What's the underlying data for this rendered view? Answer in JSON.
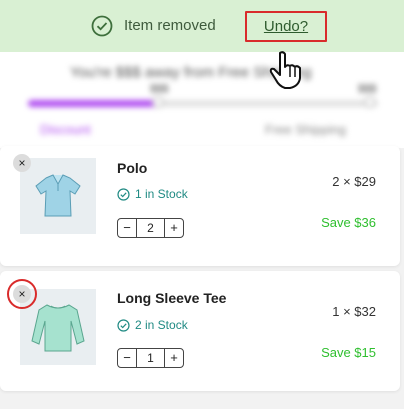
{
  "notice": {
    "message": "Item removed",
    "undo_label": "Undo?"
  },
  "shipping": {
    "text": "You're $$$ away from Free Shipping",
    "progress": 0.38,
    "tick_left_label": "$$$",
    "tick_right_label": "$$$",
    "reward_left": "Discount",
    "reward_right": "Free Shipping"
  },
  "items": [
    {
      "title": "Polo",
      "stock": "1 in Stock",
      "quantity": "2",
      "price": "2 × $29",
      "save": "Save $36",
      "remove_symbol": "×"
    },
    {
      "title": "Long Sleeve Tee",
      "stock": "2 in Stock",
      "quantity": "1",
      "price": "1 × $32",
      "save": "Save $15",
      "remove_symbol": "×"
    }
  ],
  "qty_controls": {
    "minus": "−",
    "plus": "+"
  },
  "colors": {
    "notice_bg": "#d9f0d3",
    "highlight": "#d92b2b",
    "progress": "#b14ef0",
    "stock": "#1f8a83",
    "save": "#2fbf2f"
  },
  "icons": {
    "notice": "check-circle-icon",
    "cursor": "hand-pointer-icon",
    "remove": "close-icon",
    "stock": "check-circle-icon"
  }
}
